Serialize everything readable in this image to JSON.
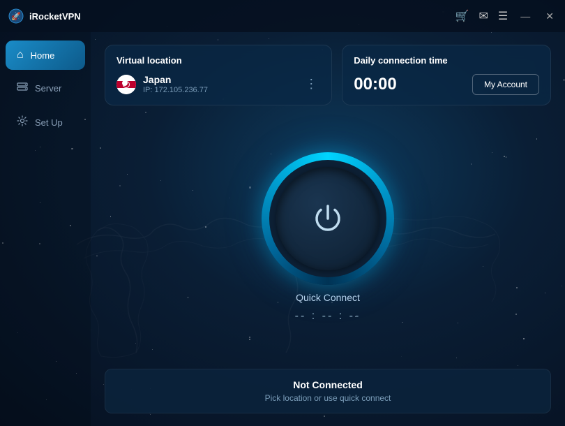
{
  "app": {
    "name": "iRocketVPN",
    "logo_text": "🚀"
  },
  "titlebar": {
    "cart_icon": "🛒",
    "mail_icon": "✉",
    "menu_icon": "☰",
    "minimize_icon": "—",
    "close_icon": "✕"
  },
  "sidebar": {
    "items": [
      {
        "id": "home",
        "label": "Home",
        "icon": "⌂",
        "active": true
      },
      {
        "id": "server",
        "label": "Server",
        "icon": "⊕",
        "active": false
      },
      {
        "id": "setup",
        "label": "Set Up",
        "icon": "⚙",
        "active": false
      }
    ]
  },
  "virtual_location": {
    "title": "Virtual location",
    "country": "Japan",
    "ip": "IP: 172.105.236.77",
    "flag_emoji": "🇯🇵"
  },
  "daily_connection": {
    "title": "Daily connection time",
    "time": "00:00",
    "account_button": "My Account"
  },
  "power_button": {
    "label": "Quick Connect",
    "timer": "-- : -- : --"
  },
  "status": {
    "title": "Not Connected",
    "subtitle": "Pick location or use quick connect"
  },
  "colors": {
    "accent_blue": "#00c8f0",
    "dark_bg": "#0a1628",
    "card_bg": "rgba(10,40,70,0.75)"
  }
}
